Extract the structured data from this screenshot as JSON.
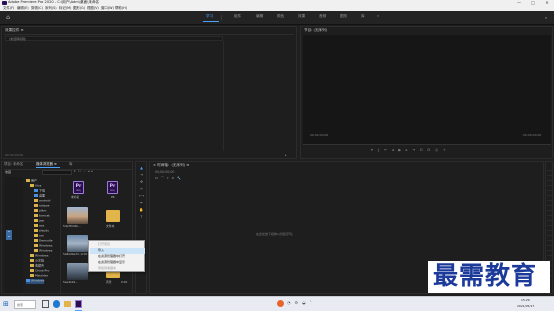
{
  "window": {
    "title": "Adobe Premiere Pro 2020 - C:\\用户\\Adm\\桌面\\未命名",
    "controls": [
      "—",
      "□",
      "✕"
    ]
  },
  "menu": [
    "文件(F)",
    "编辑(E)",
    "剪辑(C)",
    "序列(S)",
    "标记(M)",
    "图形(G)",
    "视图(V)",
    "窗口(W)",
    "帮助(H)"
  ],
  "workspaces": {
    "items": [
      "学习",
      "组件",
      "编辑",
      "颜色",
      "效果",
      "音频",
      "图形",
      "库"
    ],
    "active_index": 0,
    "more": "»"
  },
  "effect_controls": {
    "title": "效果控件 ≡",
    "placeholder": "(未选择剪辑)",
    "timecode": "00:00:00:00"
  },
  "program_monitor": {
    "title": "节目: (无序列)",
    "timecode_left": "00;00;00;00",
    "timecode_right": "00;00;00;00"
  },
  "project_panel": {
    "tabs": [
      "项目: 未命名",
      "媒体浏览器 ≡",
      "库"
    ],
    "active_tab": 1,
    "root_label": "收藏",
    "tree": [
      "用户",
      "Vins",
      "下载",
      "桌面",
      "android",
      "eclipse",
      "jdkm",
      "tomcat",
      "jasr",
      "aos",
      "shiyitu",
      "xm",
      "Demodle",
      "Windows",
      "Windows",
      "Windows",
      "小文档",
      "收藏夹",
      "China Pro",
      "Mbuilder",
      "Windows"
    ],
    "items": [
      {
        "label": "未命名",
        "type": "prproj",
        "badge": "Pr"
      },
      {
        "label": "PR",
        "type": "prproj",
        "badge": "Pr"
      },
      {
        "label": "5de3f9d4b...",
        "type": "image"
      },
      {
        "label": "文件夹",
        "type": "folder"
      },
      {
        "label": "5a8e9ba3d...",
        "type": "image"
      },
      {
        "label": "0.00",
        "type": "value"
      },
      {
        "label": "5ae4bb2...",
        "type": "image"
      },
      {
        "label": "风景",
        "type": "folder"
      },
      {
        "label": "0.00",
        "type": "value"
      }
    ]
  },
  "context_menu": {
    "items": [
      {
        "label": "打开项目",
        "state": "disabled"
      },
      {
        "label": "导入",
        "state": "highlight"
      },
      {
        "label": "在资源管理器中打开",
        "state": "normal"
      },
      {
        "label": "在资源管理器中显示",
        "state": "normal"
      },
      {
        "label": "添加到收藏夹",
        "state": "disabled"
      }
    ]
  },
  "timeline": {
    "title": "× 时间轴：(无序列) ≡",
    "timecode": "00;00;00;00",
    "empty_hint": "在此处放下媒体以创建序列。"
  },
  "taskbar": {
    "search_placeholder": "搜索",
    "time": "15:29",
    "date": "2021/05/17"
  },
  "watermark": {
    "text": "最需教育"
  },
  "colors": {
    "accent": "#4aa3ff",
    "panel_bg": "#1e1e1e",
    "premiere_purple": "#2a0e4d",
    "watermark_blue": "#1b3a9a"
  }
}
